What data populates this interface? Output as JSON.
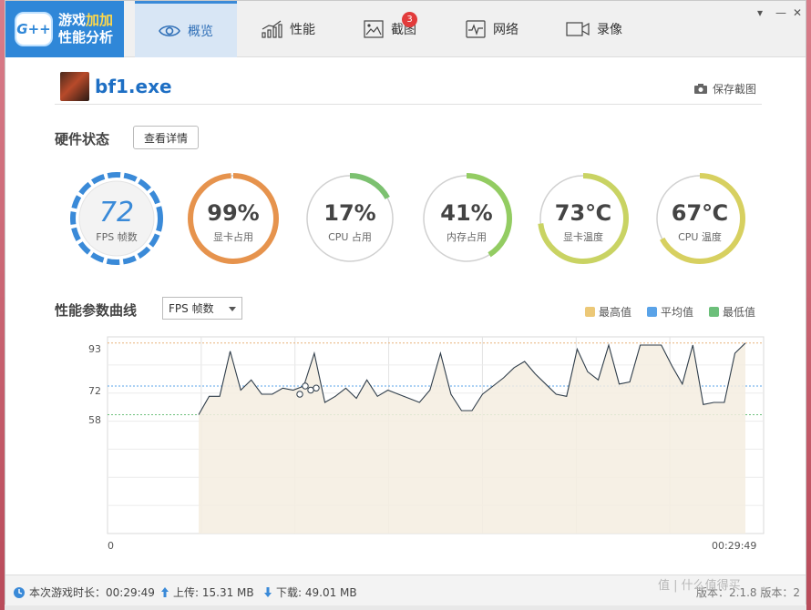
{
  "logo": {
    "badge": "G++",
    "line1_a": "游戏",
    "line1_b": "加加",
    "line2": "性能分析"
  },
  "tabs": [
    {
      "label": "概览",
      "icon": "eye-icon",
      "active": true
    },
    {
      "label": "性能",
      "icon": "bar-trend-icon"
    },
    {
      "label": "截图",
      "icon": "picture-icon",
      "badge": "3"
    },
    {
      "label": "网络",
      "icon": "pulse-icon"
    },
    {
      "label": "录像",
      "icon": "video-camera-icon"
    }
  ],
  "window_controls": {
    "menu": "▾",
    "minimize": "—",
    "close": "✕"
  },
  "app": {
    "name": "bf1.exe",
    "save_screenshot": "保存截图"
  },
  "hardware": {
    "title": "硬件状态",
    "detail_button": "查看详情",
    "gauges": [
      {
        "value": "72",
        "label": "FPS 帧数",
        "fraction": 1.0,
        "style": "fps",
        "color": "#3a8ad8"
      },
      {
        "value": "99%",
        "label": "显卡占用",
        "fraction": 0.99,
        "color": "#e6934d"
      },
      {
        "value": "17%",
        "label": "CPU 占用",
        "fraction": 0.17,
        "color": "#7cc170"
      },
      {
        "value": "41%",
        "label": "内存占用",
        "fraction": 0.41,
        "color": "#93cc62"
      },
      {
        "value": "73℃",
        "label": "显卡温度",
        "fraction": 0.73,
        "color": "#c9d363"
      },
      {
        "value": "67℃",
        "label": "CPU 温度",
        "fraction": 0.67,
        "color": "#d7d060"
      }
    ]
  },
  "curve": {
    "title": "性能参数曲线",
    "metric": "FPS 帧数",
    "legend": [
      {
        "label": "最高值",
        "color": "#ecc877"
      },
      {
        "label": "平均值",
        "color": "#5aa3e8"
      },
      {
        "label": "最低值",
        "color": "#6cbf7a"
      }
    ]
  },
  "chart_data": {
    "type": "line",
    "y_ticks": [
      "93",
      "72",
      "58"
    ],
    "x_labels": [
      "0",
      "00:29:49"
    ],
    "ylim": [
      0,
      96
    ],
    "max_value": 93,
    "avg_value": 72,
    "min_value": 58,
    "values": [
      58,
      67,
      67,
      89,
      70,
      75,
      68,
      68,
      71,
      70,
      72,
      88,
      64,
      67,
      71,
      66,
      75,
      67,
      70,
      68,
      66,
      64,
      70,
      88,
      68,
      60,
      60,
      68,
      72,
      76,
      81,
      84,
      78,
      73,
      68,
      67,
      90,
      79,
      75,
      92,
      73,
      74,
      92,
      92,
      92,
      82,
      73,
      92,
      63,
      64,
      64,
      88,
      93
    ],
    "markers": [
      68,
      72,
      70,
      71
    ]
  },
  "status": {
    "duration_label": "本次游戏时长：00:29:49",
    "upload_label": "上传: 15.31 MB",
    "download_label": "下载: 49.01 MB",
    "version_label": "版本：2.1.8 版本：2"
  },
  "watermark": "值 | 什么值得买"
}
